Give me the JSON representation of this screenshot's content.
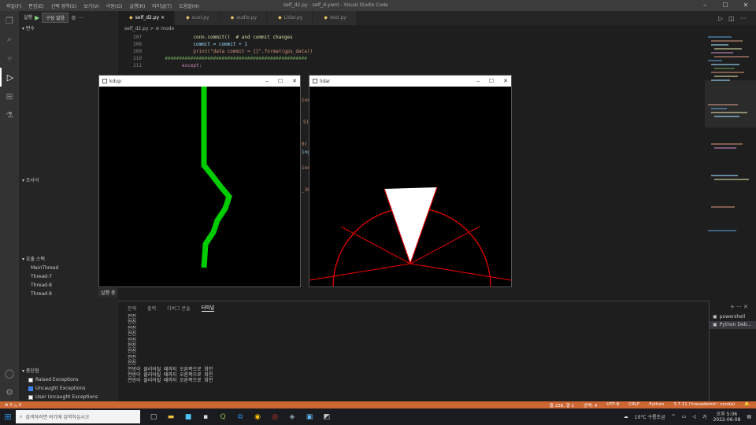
{
  "titlebar": {
    "menu": [
      "파일(F)",
      "편집(E)",
      "선택 영역(S)",
      "보기(V)",
      "이동(G)",
      "실행(R)",
      "터미널(T)",
      "도움말(H)"
    ],
    "title": "self_d2.py - self_d.yaml - Visual Studio Code"
  },
  "sidebar": {
    "header": "실행",
    "run_config": "구성 없음",
    "variables": "변수",
    "watch": "조사식",
    "callstack": "호출 스택",
    "threads": [
      "MainThread",
      "Thread-7",
      "Thread-8",
      "Thread-9"
    ],
    "breakpoints": "중단점",
    "breakpoint_items": [
      {
        "label": "Raised Exceptions",
        "checked": false
      },
      {
        "label": "Uncaught Exceptions",
        "checked": true
      },
      {
        "label": "User Uncaught Exceptions",
        "checked": false
      }
    ]
  },
  "tabs": [
    {
      "label": "self_d2.py",
      "active": true
    },
    {
      "label": "ouvi.py",
      "active": false
    },
    {
      "label": "audio.py",
      "active": false
    },
    {
      "label": "Lidar.py",
      "active": false
    },
    {
      "label": "test.py",
      "active": false
    }
  ],
  "breadcrumb": "self_d2.py > ⊘ mode",
  "code": [
    {
      "line": "207",
      "text": "            conn.commit()  # and commit changes"
    },
    {
      "line": "208",
      "text": "            commit = commit + 1"
    },
    {
      "line": "209",
      "text": "            print(\"data commit = {}\".format(gps_data))"
    },
    {
      "line": "210",
      "text": "  ##################################################"
    },
    {
      "line": "211",
      "text": "        except:"
    }
  ],
  "code_fragments": [
    "ion",
    "5)",
    "0)",
    "ing",
    "ion",
    "_30"
  ],
  "kdup_window": {
    "title": "kdup"
  },
  "lidar_window": {
    "title": "lidar"
  },
  "panel": {
    "tabs": [
      "문제",
      "출력",
      "디버그 콘솔",
      "터미널"
    ],
    "active_tab": "터미널",
    "terminal_lines": [
      "전진",
      "전진",
      "전진",
      "전진",
      "전진",
      "전진",
      "전진",
      "전진",
      "전진",
      "전방이 클리어될 때까지 오른쪽으로 회전",
      "전방이 클리어될 때까지 오른쪽으로 회전",
      "전방이 클리어될 때까지 오른쪽으로 회전"
    ],
    "terminals": [
      "powershell",
      "Python Deb..."
    ]
  },
  "status": {
    "left": "⊗ 0 △ 0",
    "items": [
      "줄 226, 열 1",
      "공백: 4",
      "UTF-8",
      "CRLF",
      "Python",
      "3.7.11 ('tracademic': conda)"
    ]
  },
  "taskbar": {
    "search_placeholder": "검색하려면 여기에 입력하십시오",
    "weather": "10°C 구름조금",
    "time": "오후 5:06",
    "date": "2022-06-08"
  },
  "colors": {
    "accent_status": "#cc6633",
    "lidar_arc": "#cc0000",
    "lidar_wedge": "#ffffff",
    "track_green": "#00cc00"
  }
}
